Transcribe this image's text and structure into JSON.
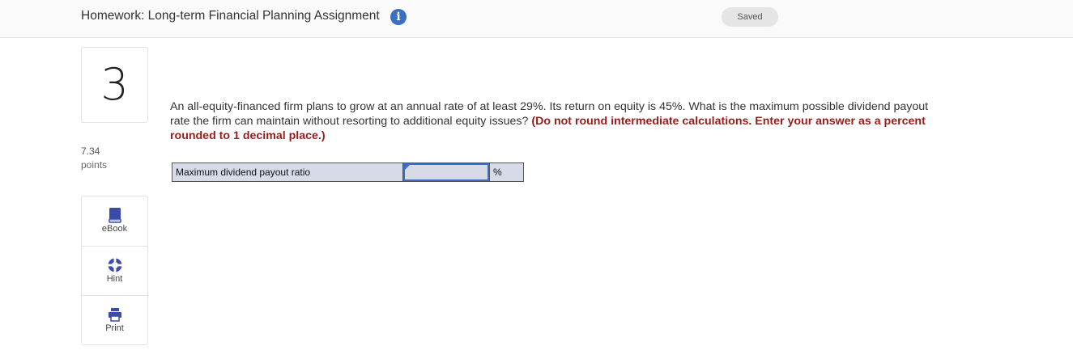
{
  "header": {
    "title": "Homework: Long-term Financial Planning Assignment",
    "info_icon": "info-icon",
    "status": "Saved"
  },
  "question_panel": {
    "number": "3",
    "points_value": "7.34",
    "points_label": "points"
  },
  "tools": [
    {
      "label": "eBook",
      "icon": "book-icon"
    },
    {
      "label": "Hint",
      "icon": "lifebuoy-icon"
    },
    {
      "label": "Print",
      "icon": "printer-icon"
    }
  ],
  "question": {
    "text": "An all-equity-financed firm plans to grow at an annual rate of at least 29%. Its return on equity is 45%. What is the maximum possible dividend payout rate the firm can maintain without resorting to additional equity issues?",
    "instruction": "(Do not round intermediate calculations. Enter your answer as a percent rounded to 1 decimal place.)"
  },
  "answer": {
    "label": "Maximum dividend payout ratio",
    "value": "",
    "unit": "%"
  },
  "colors": {
    "accent": "#3a6fc4",
    "instruction": "#9b1b1b",
    "answer_cell_bg": "#d7dbe8"
  }
}
